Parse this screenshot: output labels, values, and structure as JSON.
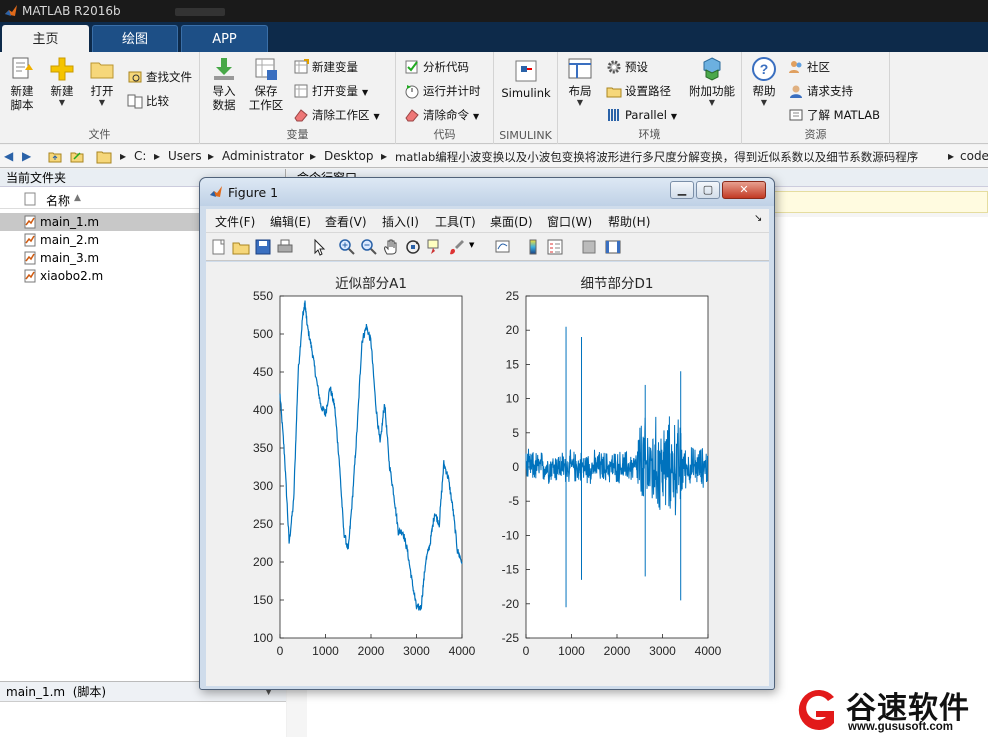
{
  "app": {
    "title": "MATLAB R2016b"
  },
  "tabs": [
    "主页",
    "绘图",
    "APP"
  ],
  "ribbon": {
    "file": {
      "label": "文件",
      "new_script": "新建\n脚本",
      "new": "新建",
      "open": "打开",
      "find_files": "查找文件",
      "compare": "比较"
    },
    "variable": {
      "label": "变量",
      "import": "导入\n数据",
      "save_ws": "保存\n工作区",
      "new_var": "新建变量",
      "open_var": "打开变量",
      "clear_ws": "清除工作区"
    },
    "code": {
      "label": "代码",
      "analyze": "分析代码",
      "run_time": "运行并计时",
      "clear_cmd": "清除命令"
    },
    "simulink": {
      "label": "SIMULINK",
      "btn": "Simulink"
    },
    "env": {
      "label": "环境",
      "layout": "布局",
      "prefs": "预设",
      "set_path": "设置路径",
      "parallel": "Parallel",
      "addons": "附加功能"
    },
    "resources": {
      "label": "资源",
      "help": "帮助",
      "community": "社区",
      "support": "请求支持",
      "learn": "了解 MATLAB"
    }
  },
  "address": {
    "segments": [
      "C:",
      "Users",
      "Administrator",
      "Desktop",
      "matlab编程小波变换以及小波包变换将波形进行多尺度分解变换，得到近似系数以及细节系数源码程序",
      "code"
    ]
  },
  "current_folder": {
    "title": "当前文件夹",
    "col_name": "名称",
    "files": [
      "main_1.m",
      "main_2.m",
      "main_3.m",
      "xiaobo2.m"
    ],
    "detail": "main_1.m  (脚本)"
  },
  "command_window": {
    "title": "命令行窗口"
  },
  "figure": {
    "title": "Figure 1",
    "menu": [
      "文件(F)",
      "编辑(E)",
      "查看(V)",
      "插入(I)",
      "工具(T)",
      "桌面(D)",
      "窗口(W)",
      "帮助(H)"
    ],
    "toolbar_icons": [
      "new-figure-icon",
      "open-file-icon",
      "save-icon",
      "print-icon",
      "pointer-icon",
      "zoom-in-icon",
      "zoom-out-icon",
      "pan-hand-icon",
      "rotate-3d-icon",
      "data-cursor-icon",
      "brush-icon",
      "link-plot-icon",
      "colorbar-icon",
      "legend-icon",
      "hide-plot-tools-icon",
      "show-plot-tools-icon"
    ]
  },
  "chart_data": [
    {
      "type": "line",
      "title": "近似部分A1",
      "xlim": [
        0,
        4000
      ],
      "ylim": [
        100,
        550
      ],
      "xticks": [
        0,
        1000,
        2000,
        3000,
        4000
      ],
      "yticks": [
        100,
        150,
        200,
        250,
        300,
        350,
        400,
        450,
        500,
        550
      ],
      "color": "#0072BD",
      "x": [
        0,
        100,
        200,
        300,
        400,
        500,
        550,
        600,
        700,
        800,
        900,
        1000,
        1100,
        1200,
        1300,
        1400,
        1500,
        1600,
        1700,
        1800,
        1900,
        2000,
        2100,
        2200,
        2300,
        2400,
        2500,
        2600,
        2700,
        2800,
        2900,
        3000,
        3100,
        3200,
        3300,
        3400,
        3500,
        3600,
        3700,
        3800,
        3900,
        4000
      ],
      "y": [
        420,
        340,
        225,
        280,
        450,
        525,
        540,
        510,
        480,
        440,
        405,
        395,
        430,
        405,
        335,
        240,
        215,
        290,
        380,
        490,
        510,
        490,
        410,
        355,
        410,
        330,
        290,
        240,
        240,
        215,
        175,
        140,
        140,
        200,
        225,
        265,
        250,
        330,
        310,
        270,
        215,
        200
      ]
    },
    {
      "type": "line",
      "title": "细节部分D1",
      "xlim": [
        0,
        4000
      ],
      "ylim": [
        -25,
        25
      ],
      "xticks": [
        0,
        1000,
        2000,
        3000,
        4000
      ],
      "yticks": [
        -25,
        -20,
        -15,
        -10,
        -5,
        0,
        5,
        10,
        15,
        20,
        25
      ],
      "color": "#0072BD",
      "noise": [
        {
          "from": 0,
          "to": 2450,
          "amp": 2
        },
        {
          "from": 2450,
          "to": 3450,
          "amp": 6
        },
        {
          "from": 3450,
          "to": 4000,
          "amp": 2.5
        }
      ],
      "spikes": [
        {
          "x": 880,
          "y": 20.5
        },
        {
          "x": 880,
          "y": -20.5
        },
        {
          "x": 1220,
          "y": 19
        },
        {
          "x": 1220,
          "y": -16.5
        },
        {
          "x": 2620,
          "y": 12
        },
        {
          "x": 2620,
          "y": -16
        },
        {
          "x": 3400,
          "y": 14
        },
        {
          "x": 3400,
          "y": -19.5
        }
      ]
    }
  ],
  "watermark": {
    "brand": "谷速软件",
    "url": "www.gususoft.com"
  }
}
